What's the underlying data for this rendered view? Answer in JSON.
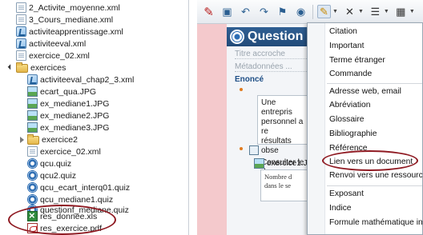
{
  "tree": {
    "items": [
      {
        "label": "2_Activite_moyenne.xml",
        "icon": "xml-doc-icon"
      },
      {
        "label": "3_Cours_mediane.xml",
        "icon": "doc-icon"
      },
      {
        "label": "activiteapprentissage.xml",
        "icon": "activity-xml-icon"
      },
      {
        "label": "activiteeval.xml",
        "icon": "activity-xml-icon"
      },
      {
        "label": "exercice_02.xml",
        "icon": "doc-icon"
      },
      {
        "label": "exercices",
        "icon": "folder-icon"
      },
      {
        "label": "activiteeval_chap2_3.xml",
        "icon": "activity-xml-icon"
      },
      {
        "label": "ecart_qua.JPG",
        "icon": "image-icon"
      },
      {
        "label": "ex_mediane1.JPG",
        "icon": "image-icon"
      },
      {
        "label": "ex_mediane2.JPG",
        "icon": "image-icon"
      },
      {
        "label": "ex_mediane3.JPG",
        "icon": "image-icon"
      },
      {
        "label": "exercice2",
        "icon": "folder-icon"
      },
      {
        "label": "exercice_02.xml",
        "icon": "doc-icon"
      },
      {
        "label": "qcu.quiz",
        "icon": "quiz-icon"
      },
      {
        "label": "qcu2.quiz",
        "icon": "quiz-icon"
      },
      {
        "label": "qcu_ecart_interq01.quiz",
        "icon": "quiz-icon"
      },
      {
        "label": "qcu_mediane1.quiz",
        "icon": "quiz-icon"
      },
      {
        "label": "questionf_mediane.quiz",
        "icon": "quiz-icon"
      },
      {
        "label": "res_donnee.xls",
        "icon": "excel-icon"
      },
      {
        "label": "res_exercice.pdf",
        "icon": "pdf-icon"
      }
    ]
  },
  "toolbar": {
    "icons": [
      "pen-icon",
      "save-icon",
      "undo-icon",
      "redo-icon",
      "bookmark-icon",
      "mark-icon",
      "highlight-icon",
      "clear-format-icon",
      "list-icon",
      "table-icon"
    ]
  },
  "editor": {
    "title": "Question",
    "title_placeholder": "Titre accroche",
    "meta_placeholder": "Métadonnées ...",
    "section": "Enoncé",
    "para_line1": "Une entrepris",
    "para_line2": "personnel a re",
    "para_line3": "résultats obse",
    "para_line4": "Consulter le d",
    "image_label": "exercice1.JP",
    "table_line1": "Nombre d",
    "table_line2": "dans le se"
  },
  "menu": {
    "items": [
      "Citation",
      "Important",
      "Terme étranger",
      "Commande",
      "Adresse web, email",
      "Abréviation",
      "Glossaire",
      "Bibliographie",
      "Référence",
      "Lien vers un document",
      "Renvoi vers une ressource",
      "Exposant",
      "Indice",
      "Formule mathématique inte"
    ]
  },
  "colors": {
    "title_bar": "#2f5f93",
    "annotation_ellipse": "#8f1a22",
    "gutter": "#f4c9cc"
  }
}
